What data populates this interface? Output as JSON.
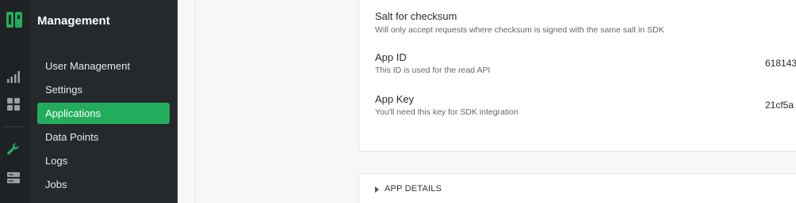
{
  "rail": {
    "icons": [
      "app-logo-icon",
      "analytics-icon",
      "dashboard-grid-icon",
      "wrench-icon",
      "server-icon"
    ]
  },
  "sidebar": {
    "title": "Management",
    "items": [
      {
        "label": "User Management",
        "active": false
      },
      {
        "label": "Settings",
        "active": false
      },
      {
        "label": "Applications",
        "active": true
      },
      {
        "label": "Data Points",
        "active": false
      },
      {
        "label": "Logs",
        "active": false
      },
      {
        "label": "Jobs",
        "active": false
      }
    ]
  },
  "app_settings": {
    "salt": {
      "label": "Salt for checksum",
      "description": "Will only accept requests where checksum is signed with the same salt in SDK"
    },
    "app_id": {
      "label": "App ID",
      "description": "This ID is used for the read API",
      "value": "618143"
    },
    "app_key": {
      "label": "App Key",
      "description": "You'll need this key for SDK integration",
      "value": "21cf5a"
    }
  },
  "app_details": {
    "label": "APP DETAILS"
  },
  "colors": {
    "accent": "#22ad5c",
    "rail_bg": "#1f2225",
    "sidebar_bg": "#26292c"
  }
}
